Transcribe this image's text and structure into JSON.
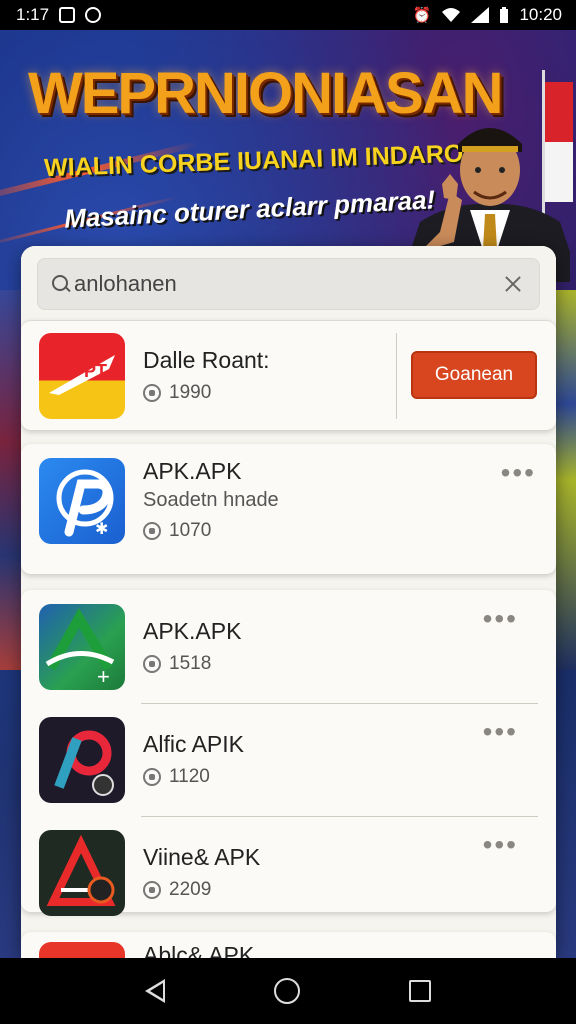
{
  "status_bar": {
    "time_left": "1:17",
    "time_right": "10:20"
  },
  "banner": {
    "title": "WEPRNIONIASAN",
    "subtitle": "WIALIN CORBE  IUANAI IM INDAROVIA\"",
    "tagline": "Masainc oturer aclarr pmaraa!"
  },
  "search": {
    "query": "anlohanen",
    "placeholder": "anlohanen"
  },
  "featured_app": {
    "name": "Dalle Roant:",
    "count": "1990",
    "button_label": "Goanean",
    "icon_text": "APPT"
  },
  "apps": [
    {
      "name": "APK.APK",
      "subtitle": "Soadetn hnade",
      "count": "1070"
    },
    {
      "name": "APK.APK",
      "count": "1518"
    },
    {
      "name": "Alfic APIK",
      "count": "1120"
    },
    {
      "name": "Viine& APK",
      "count": "2209"
    },
    {
      "name": "Ablc& APK"
    }
  ],
  "more_label": "•••",
  "colors": {
    "accent_button": "#d8461f",
    "banner_title": "#f3a11a",
    "panel_bg": "#f6f4ee"
  },
  "icons": {
    "search": "search-icon",
    "clear": "close-icon",
    "downloads": "download-count-icon",
    "more": "more-options-icon",
    "nav_back": "back-icon",
    "nav_home": "home-icon",
    "nav_recent": "recent-apps-icon"
  }
}
